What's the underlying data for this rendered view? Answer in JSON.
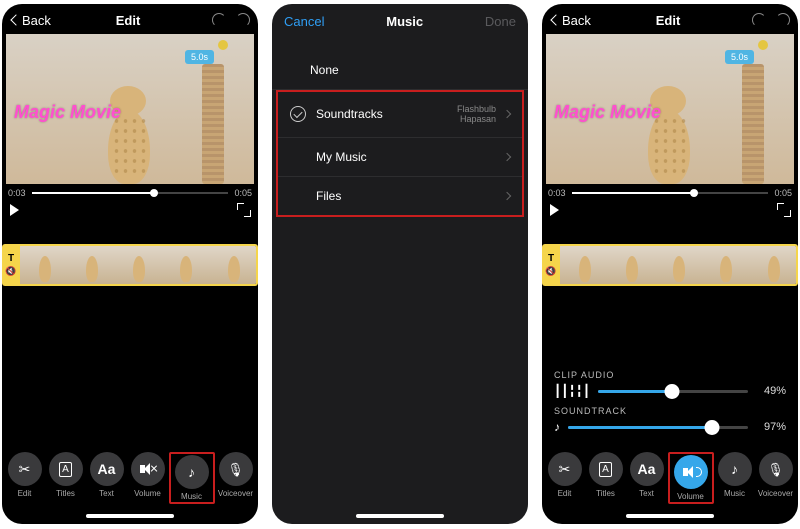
{
  "phone1": {
    "back": "Back",
    "title": "Edit",
    "duration_chip": "5.0s",
    "overlay": "Magic Movie",
    "time_start": "0:03",
    "time_end": "0:05",
    "playhead_pct": 62,
    "timeline_badge": "T",
    "tools": {
      "edit": "Edit",
      "titles": "Titles",
      "text": "Text",
      "text_icon": "Aa",
      "volume": "Volume",
      "music": "Music",
      "voiceover": "Voiceover"
    }
  },
  "phone2": {
    "cancel": "Cancel",
    "title": "Music",
    "done": "Done",
    "none": "None",
    "soundtracks": "Soundtracks",
    "soundtracks_sub1": "Flashbulb",
    "soundtracks_sub2": "Hapasan",
    "mymusic": "My Music",
    "files": "Files"
  },
  "phone3": {
    "back": "Back",
    "title": "Edit",
    "duration_chip": "5.0s",
    "overlay": "Magic Movie",
    "time_start": "0:03",
    "time_end": "0:05",
    "playhead_pct": 62,
    "timeline_badge": "T",
    "clip_audio_label": "CLIP AUDIO",
    "clip_audio_pct": "49%",
    "clip_audio_val": 49,
    "soundtrack_label": "SOUNDTRACK",
    "soundtrack_pct": "97%",
    "soundtrack_val": 80,
    "tools": {
      "edit": "Edit",
      "titles": "Titles",
      "text": "Text",
      "text_icon": "Aa",
      "volume": "Volume",
      "music": "Music",
      "voiceover": "Voiceover"
    }
  }
}
